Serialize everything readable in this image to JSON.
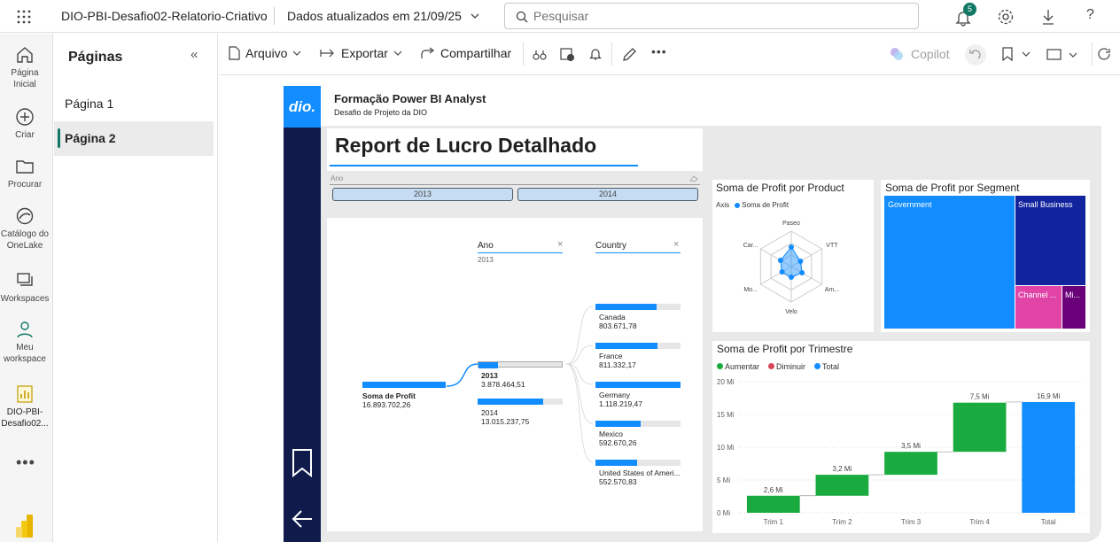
{
  "topbar": {
    "report_name": "DIO-PBI-Desafio02-Relatorio-Criativo",
    "updated": "Dados atualizados em 21/09/25",
    "search_placeholder": "Pesquisar",
    "notif_count": "5"
  },
  "leftnav": [
    {
      "label": "Página Inicial",
      "icon": "home-icon"
    },
    {
      "label": "Criar",
      "icon": "plus-icon"
    },
    {
      "label": "Procurar",
      "icon": "folder-icon"
    },
    {
      "label": "Catálogo do OneLake",
      "icon": "onelake-icon"
    },
    {
      "label": "Workspaces",
      "icon": "workspaces-icon"
    },
    {
      "label": "Meu workspace",
      "icon": "person-icon"
    },
    {
      "label": "DIO-PBI-Desafio02...",
      "icon": "report-icon"
    }
  ],
  "pages": {
    "title": "Páginas",
    "items": [
      "Página 1",
      "Página 2"
    ],
    "selected": 1
  },
  "toolbar": {
    "file": "Arquivo",
    "export": "Exportar",
    "share": "Compartilhar",
    "copilot": "Copilot"
  },
  "report": {
    "course": "Formação Power BI Analyst",
    "subtitle": "Desafio de Projeto da DIO",
    "title": "Report de Lucro Detalhado",
    "logo": "dio.",
    "slicer": {
      "label": "Ano",
      "options": [
        "2013",
        "2014"
      ]
    },
    "tree": {
      "root_label": "Soma de Profit",
      "root_value": "16.893.702,26",
      "level1_header": "Ano",
      "level1_filter": "2013",
      "level2_header": "Country",
      "years": [
        {
          "label": "2013",
          "value": "3.878.464,51",
          "fraction": 0.23
        },
        {
          "label": "2014",
          "value": "13.015.237,75",
          "fraction": 0.77
        }
      ],
      "countries": [
        {
          "label": "Canada",
          "value": "803.671,78",
          "fraction": 0.72
        },
        {
          "label": "France",
          "value": "811.332,17",
          "fraction": 0.73
        },
        {
          "label": "Germany",
          "value": "1.118.219,47",
          "fraction": 1.0
        },
        {
          "label": "Mexico",
          "value": "592.670,26",
          "fraction": 0.53
        },
        {
          "label": "United States of Ameri...",
          "value": "552.570,83",
          "fraction": 0.49
        }
      ]
    },
    "radar": {
      "title": "Soma de Profit por Product",
      "legend_axis": "Axis",
      "legend_series": "Soma de Profit",
      "labels": [
        "Paseo",
        "VTT",
        "Am...",
        "Velo",
        "Mo...",
        "Car..."
      ]
    },
    "treemap": {
      "title": "Soma de Profit por Segment",
      "segments": [
        "Government",
        "Small Business",
        "Channel ...",
        "Mi..."
      ],
      "colors": [
        "#118dff",
        "#12239e",
        "#e044a7",
        "#6b007b"
      ]
    },
    "waterfall": {
      "title": "Soma de Profit por Trimestre",
      "legend": [
        "Aumentar",
        "Diminuir",
        "Total"
      ],
      "legend_colors": [
        "#1aab40",
        "#d64554",
        "#118dff"
      ]
    }
  },
  "chart_data": {
    "type": "bar",
    "title": "Soma de Profit por Trimestre",
    "categories": [
      "Trim 1",
      "Trim 2",
      "Trim 3",
      "Trim 4",
      "Total"
    ],
    "values": [
      2.6,
      3.2,
      3.5,
      7.5,
      16.9
    ],
    "value_labels": [
      "2,6 Mi",
      "3,2 Mi",
      "3,5 Mi",
      "7,5 Mi",
      "16,9 Mi"
    ],
    "yticks": [
      "0 Mi",
      "5 Mi",
      "10 Mi",
      "15 Mi",
      "20 Mi"
    ],
    "ylim": [
      0,
      20
    ]
  }
}
